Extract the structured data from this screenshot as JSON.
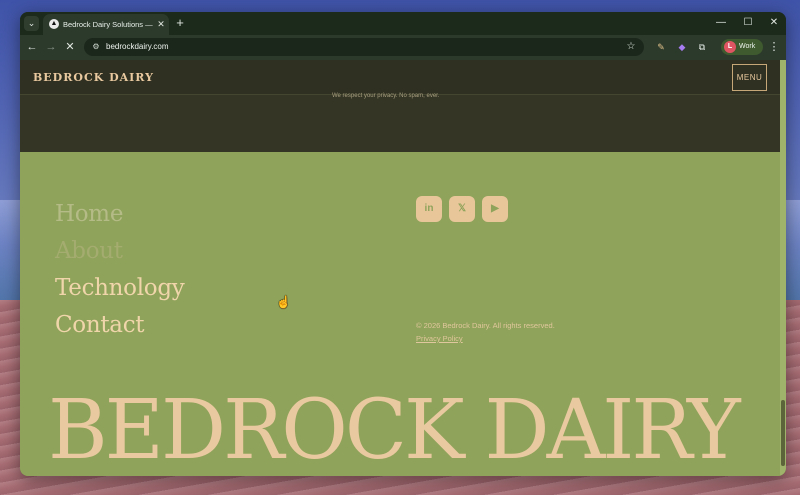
{
  "browser": {
    "tab_dropdown_icon": "⌄",
    "tab": {
      "title": "Bedrock Dairy Solutions — Knc",
      "favicon_glyph": "▲",
      "close_glyph": "✕"
    },
    "new_tab_glyph": "+",
    "window_controls": {
      "minimize": "—",
      "maximize": "☐",
      "close": "✕"
    },
    "nav": {
      "back": "←",
      "forward": "→",
      "reload": "✕"
    },
    "url": "bedrockdairy.com",
    "site_info_glyph": "⚙",
    "star_glyph": "☆",
    "tools": {
      "pen": "✎",
      "extension_badge": "◆",
      "puzzle": "⧉"
    },
    "profile": {
      "initial": "L",
      "label": "Work",
      "color": "#e05562"
    },
    "menu_glyph": "⋮"
  },
  "site": {
    "brand": "BEDROCK DAIRY",
    "menu_label": "MENU",
    "privacy_note": "We respect your privacy. No spam, ever.",
    "footer": {
      "nav": [
        {
          "label": "Home",
          "color": "#b5bb86"
        },
        {
          "label": "About",
          "color": "#a4ac6f"
        },
        {
          "label": "Technology",
          "color": "#f0d5ab"
        },
        {
          "label": "Contact",
          "color": "#f0d5ab"
        }
      ],
      "social": [
        {
          "name": "linkedin-icon",
          "glyph": "in"
        },
        {
          "name": "x-icon",
          "glyph": "𝕏"
        },
        {
          "name": "youtube-icon",
          "glyph": "▶"
        }
      ],
      "copyright": "© 2026 Bedrock Dairy. All rights reserved.",
      "privacy_link": "Privacy Policy",
      "wordmark": "BEDROCK DAIRY"
    }
  },
  "colors": {
    "accent_cream": "#e9c9a0",
    "footer_green": "#8fa35a",
    "header_dark": "#2f3021"
  }
}
